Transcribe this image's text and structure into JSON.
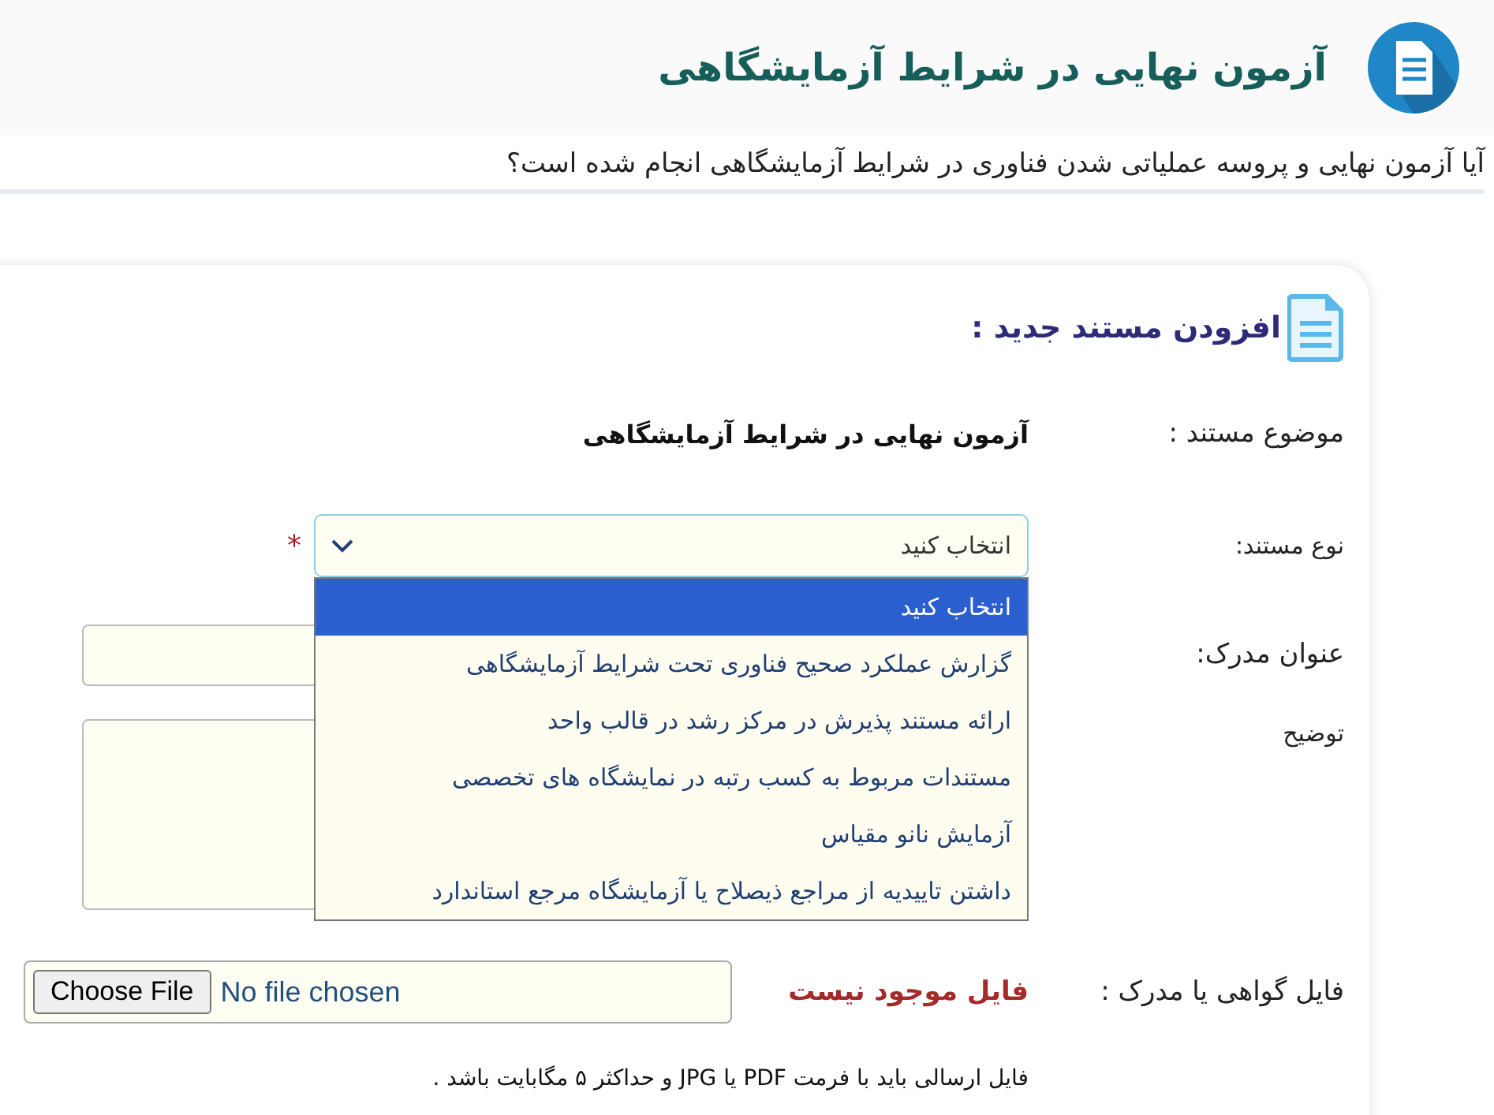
{
  "header": {
    "title": "آزمون نهایی در شرایط آزمایشگاهی",
    "question": "آیا آزمون نهایی و پروسه عملیاتی شدن فناوری در شرایط آزمایشگاهی انجام شده است؟"
  },
  "card": {
    "heading": "افزودن مستند جدید :",
    "subject": {
      "label": "موضوع مستند :",
      "value": "آزمون نهایی در شرایط آزمایشگاهی"
    },
    "doc_type": {
      "label": "نوع مستند:",
      "value": "انتخاب کنید",
      "required_mark": "*",
      "expanded": true,
      "options": [
        {
          "label": "انتخاب کنید",
          "selected": true
        },
        {
          "label": "گزارش عملکرد صحیح فناوری تحت شرایط آزمایشگاهی",
          "selected": false
        },
        {
          "label": "ارائه مستند پذیرش در مرکز رشد در قالب واحد",
          "selected": false
        },
        {
          "label": "مستندات مربوط به کسب رتبه در نمایشگاه های تخصصی",
          "selected": false
        },
        {
          "label": "آزمایش نانو مقیاس",
          "selected": false
        },
        {
          "label": "داشتن تاییدیه از مراجع ذیصلاح یا آزمایشگاه مرجع استاندارد",
          "selected": false
        }
      ]
    },
    "doc_title": {
      "label": "عنوان مدرک:"
    },
    "description": {
      "label": "توضیح"
    },
    "file": {
      "label": "فایل گواهی یا مدرک :",
      "status": "فایل موجود نیست",
      "button": "Choose File",
      "value": "No file chosen"
    },
    "note": "فایل ارسالی باید با فرمت PDF یا JPG و حداکثر ۵ مگابایت باشد ."
  }
}
